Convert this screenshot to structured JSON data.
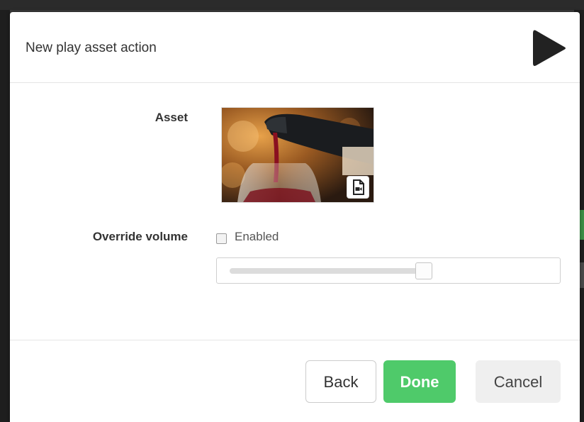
{
  "dialog": {
    "title": "New play asset action"
  },
  "form": {
    "asset_label": "Asset",
    "asset_badge_icon": "video-file-icon",
    "override_volume_label": "Override volume",
    "enabled_label": "Enabled",
    "enabled_checked": false,
    "volume_level": 0.61
  },
  "buttons": {
    "back": "Back",
    "done": "Done",
    "cancel": "Cancel"
  },
  "colors": {
    "done_green": "#4fca6a",
    "cancel_grey": "#efefef",
    "play_icon": "#222222"
  }
}
